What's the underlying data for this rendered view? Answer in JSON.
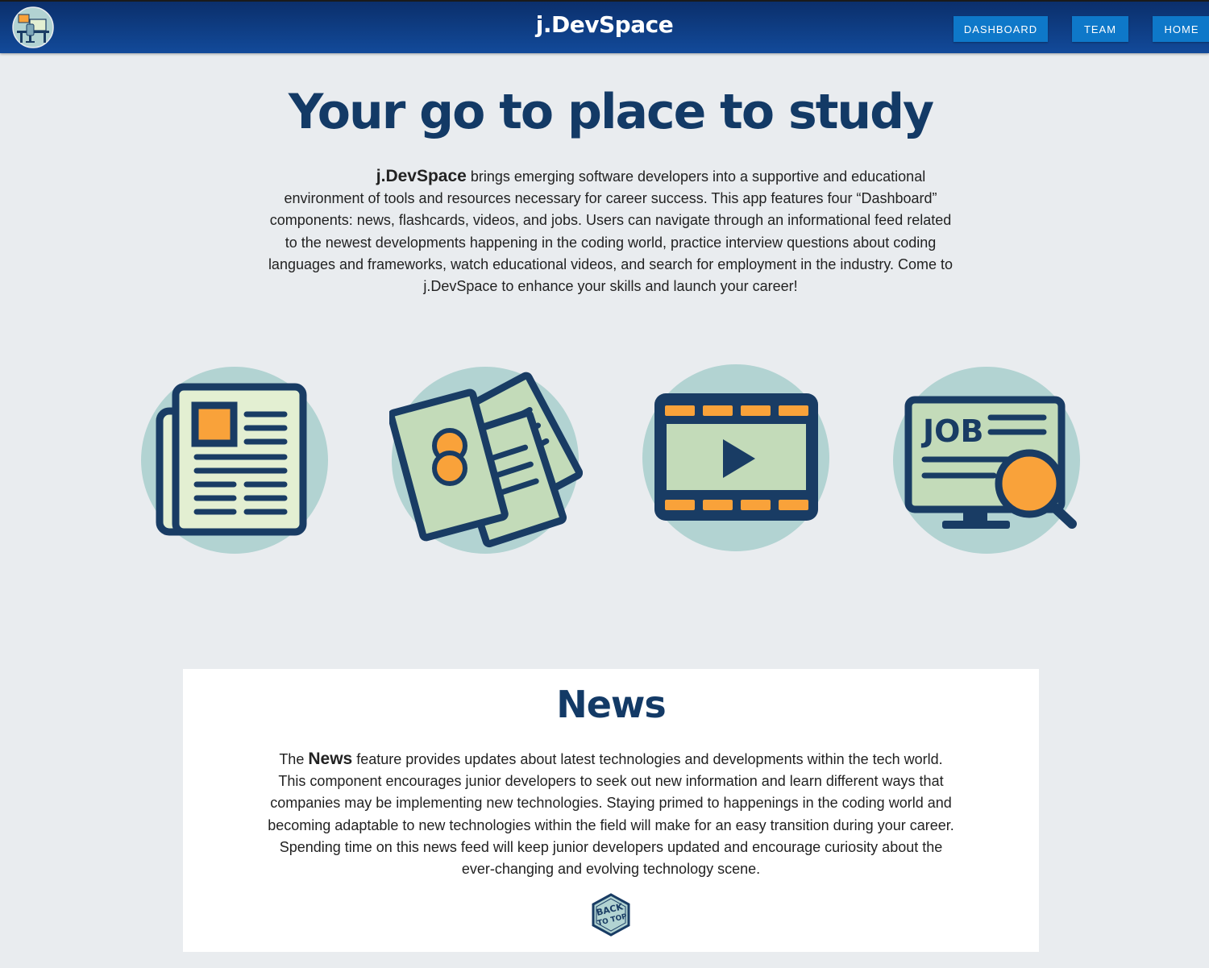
{
  "navbar": {
    "brand": "j.DevSpace",
    "buttons": {
      "dashboard": "DASHBOARD",
      "team": "TEAM",
      "home": "HOME"
    },
    "colors": {
      "bar": "#0e3f85",
      "button": "#0e78c9"
    }
  },
  "hero": {
    "title": "Your go to place to study",
    "intro_strong": "j.DevSpace",
    "intro_text": " brings emerging software developers into a supportive and educational environment of tools and resources necessary for career success. This app features four “Dashboard” components: news, flashcards, videos, and jobs. Users can navigate through an informational feed related to the newest developments happening in the coding world, practice interview questions about coding languages and frameworks, watch educational videos, and search for employment in the industry. Come to j.DevSpace to enhance your skills and launch your career!"
  },
  "features": [
    {
      "name": "news",
      "icon": "newspaper-icon"
    },
    {
      "name": "flashcards",
      "icon": "flashcards-icon"
    },
    {
      "name": "videos",
      "icon": "video-player-icon"
    },
    {
      "name": "jobs",
      "icon": "job-search-icon"
    }
  ],
  "news": {
    "title": "News",
    "text_prefix": "The ",
    "text_strong": "News",
    "text_body": " feature provides updates about latest technologies and developments within the tech world. This component encourages junior developers to seek out new information and learn different ways that companies may be implementing new technologies. Staying primed to happenings in the coding world and becoming adaptable to new technologies within the field will make for an easy transition during your career. Spending time on this news feed will keep junior developers updated and encourage curiosity about the ever-changing and evolving technology scene.",
    "back_to_top_line1": "BACK",
    "back_to_top_line2": "TO TOP"
  },
  "palette": {
    "navy": "#193c64",
    "teal_circle": "#b2d3d2",
    "cream": "#e3efd2",
    "green": "#c3dbb9",
    "orange": "#f9a23a",
    "page_bg": "#e9ecef"
  }
}
